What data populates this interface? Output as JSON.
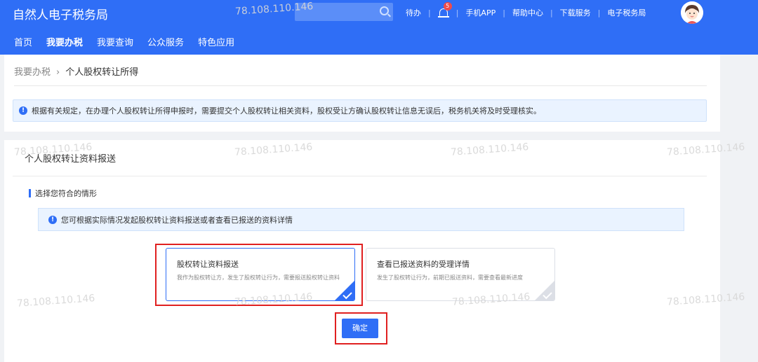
{
  "header": {
    "brand": "自然人电子税务局",
    "todo": "待办",
    "notification_count": "5",
    "links": [
      "手机APP",
      "帮助中心",
      "下载服务",
      "电子税务局"
    ]
  },
  "nav": [
    "首页",
    "我要办税",
    "我要查询",
    "公众服务",
    "特色应用"
  ],
  "breadcrumb": {
    "parent": "我要办税",
    "current": "个人股权转让所得"
  },
  "notice": "根据有关规定，在办理个人股权转让所得申报时，需要提交个人股权转让相关资料，股权受让方确认股权转让信息无误后，税务机关将及时受理核实。",
  "panel": {
    "title": "个人股权转让资料报送",
    "section_label": "选择您符合的情形",
    "tip": "您可根据实际情况发起股权转让资料报送或者查看已报送的资料详情"
  },
  "cards": [
    {
      "title": "股权转让资料报送",
      "desc": "我作为股权转让方，发生了股权转让行为，需要报送股权转让资料"
    },
    {
      "title": "查看已报送资料的受理详情",
      "desc": "发生了股权转让行为，前期已报送资料，需要查看最新进度"
    }
  ],
  "confirm_label": "确定",
  "watermark": "78.108.110.146",
  "colors": {
    "primary": "#2f6ef6",
    "highlight": "#e02020"
  }
}
